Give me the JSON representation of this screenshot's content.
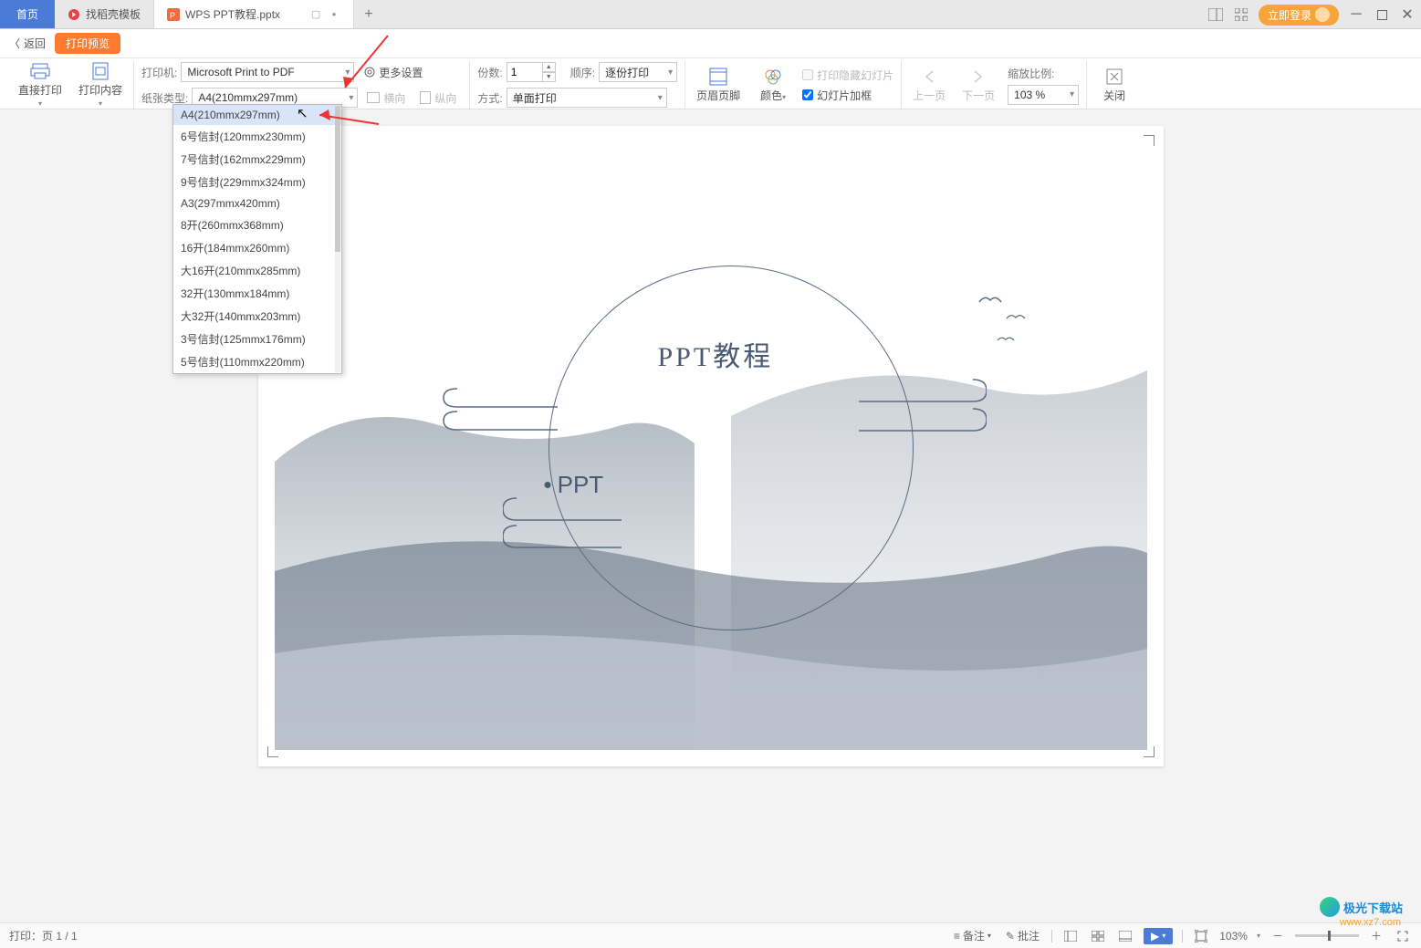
{
  "tabs": {
    "home": "首页",
    "template": "找稻壳模板",
    "file": "WPS PPT教程.pptx"
  },
  "login_button": "立即登录",
  "crumb": {
    "back": "返回",
    "preview_pill": "打印预览"
  },
  "toolbar": {
    "direct_print": "直接打印",
    "print_content": "打印内容",
    "printer_label": "打印机:",
    "printer_value": "Microsoft Print to PDF",
    "more_settings": "更多设置",
    "paper_type_label": "纸张类型:",
    "paper_type_value": "A4(210mmx297mm)",
    "landscape": "横向",
    "portrait": "纵向",
    "copies_label": "份数:",
    "copies_value": "1",
    "order_label": "顺序:",
    "order_value": "逐份打印",
    "mode_label": "方式:",
    "mode_value": "单面打印",
    "header_footer": "页眉页脚",
    "color": "颜色",
    "chk_hidden": "打印隐藏幻灯片",
    "chk_frame": "幻灯片加框",
    "prev_page": "上一页",
    "next_page": "下一页",
    "zoom_label": "缩放比例:",
    "zoom_value": "103 %",
    "close": "关闭"
  },
  "paper_options": [
    "A4(210mmx297mm)",
    "6号信封(120mmx230mm)",
    "7号信封(162mmx229mm)",
    "9号信封(229mmx324mm)",
    "A3(297mmx420mm)",
    "8开(260mmx368mm)",
    "16开(184mmx260mm)",
    "大16开(210mmx285mm)",
    "32开(130mmx184mm)",
    "大32开(140mmx203mm)",
    "3号信封(125mmx176mm)",
    "5号信封(110mmx220mm)"
  ],
  "slide": {
    "title": "PPT教程",
    "subtitle": "PPT"
  },
  "status": {
    "page_text": "打印：页 1 / 1",
    "notes": "备注",
    "comments": "批注",
    "zoom_value": "103%"
  },
  "watermark": {
    "name": "极光下载站",
    "url": "www.xz7.com"
  }
}
